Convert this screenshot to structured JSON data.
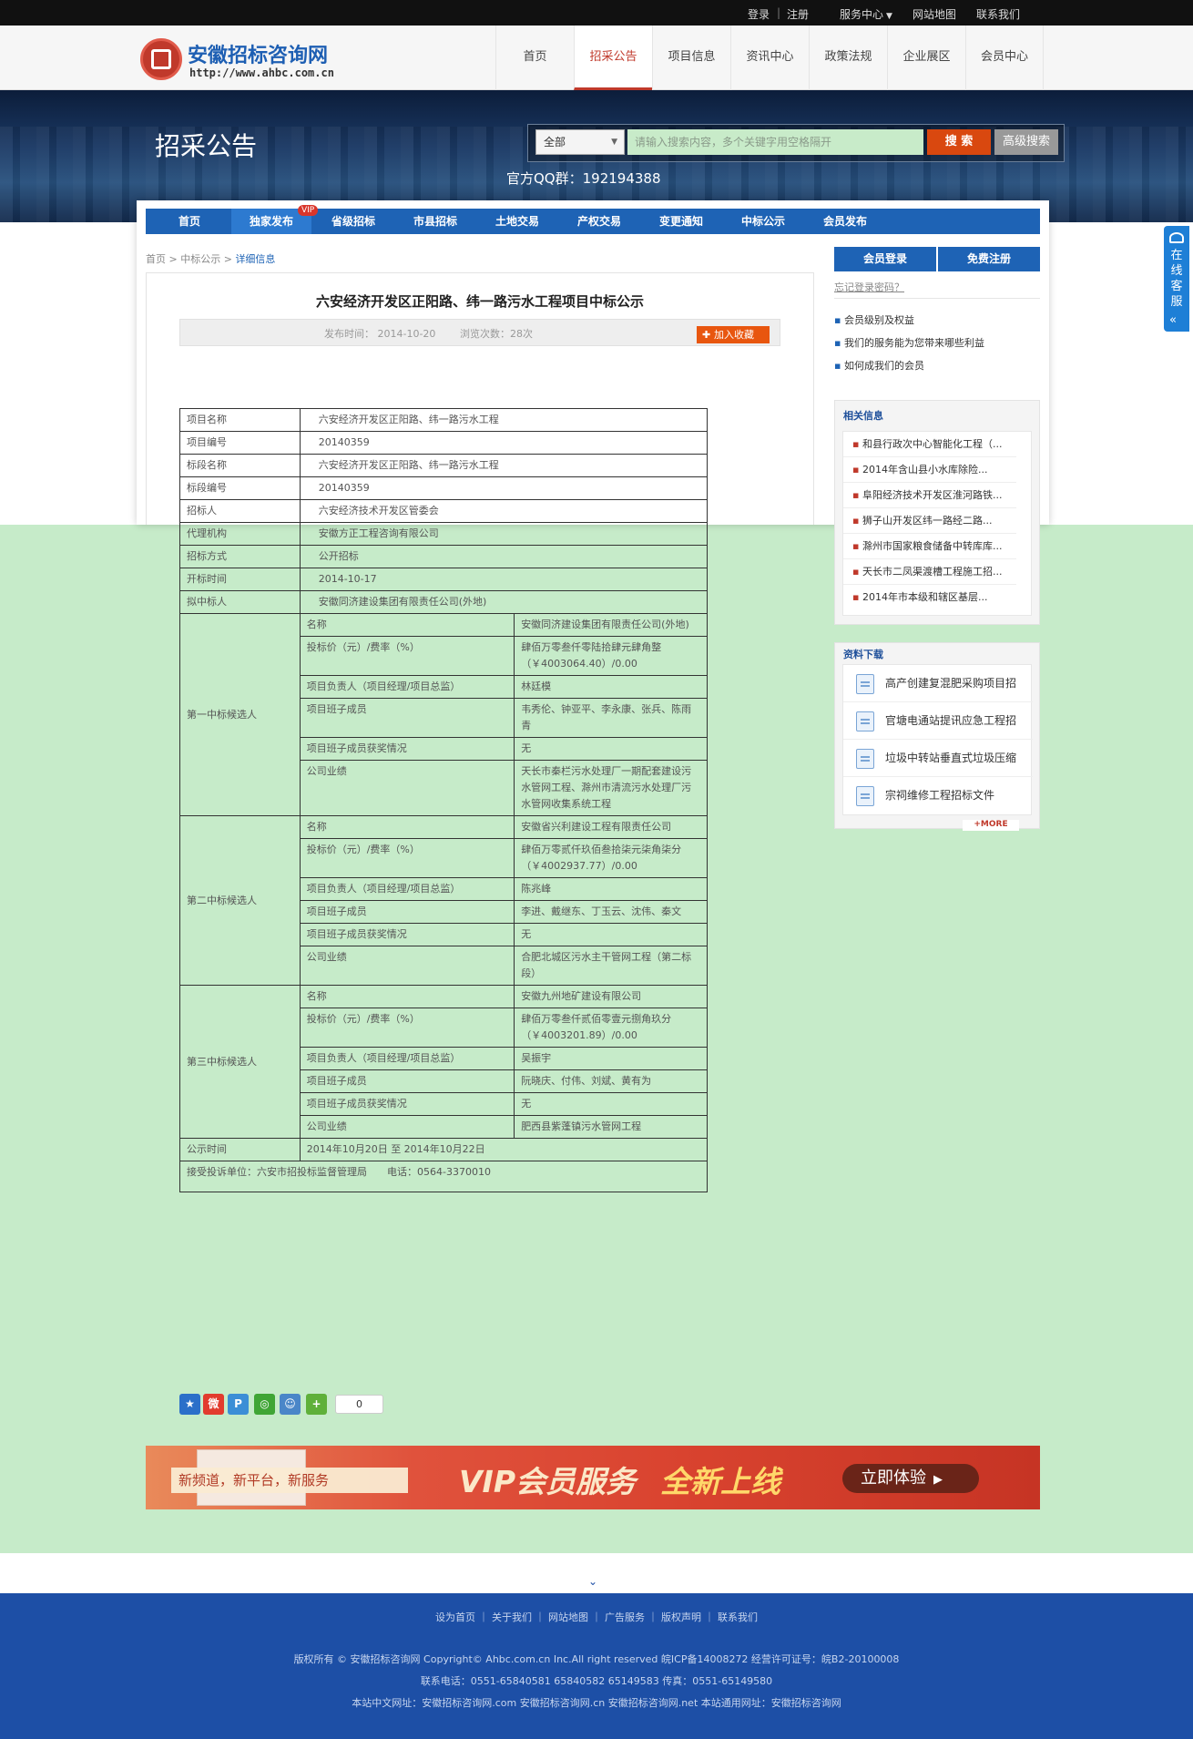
{
  "topbar": {
    "login": "登录",
    "sep": "|",
    "register": "注册",
    "service": "服务中心",
    "sitemap": "网站地图",
    "contact": "联系我们"
  },
  "header": {
    "logo_cn": "安徽招标咨询网",
    "logo_url": "http://www.ahbc.com.cn",
    "nav": [
      "首页",
      "招采公告",
      "项目信息",
      "资讯中心",
      "政策法规",
      "企业展区",
      "会员中心"
    ]
  },
  "banner": {
    "title": "招采公告",
    "select_value": "全部",
    "search_placeholder": "请输入搜索内容，多个关键字用空格隔开",
    "search_btn": "搜 索",
    "adv_btn": "高级搜索",
    "qq": "官方QQ群：192194388"
  },
  "subnav": [
    "首页",
    "独家发布",
    "省级招标",
    "市县招标",
    "土地交易",
    "产权交易",
    "变更通知",
    "中标公示",
    "会员发布"
  ],
  "vip_badge": "VIP",
  "breadcrumb": [
    "首页",
    "中标公示",
    "详细信息"
  ],
  "article": {
    "title": "六安经济开发区正阳路、纬一路污水工程项目中标公示",
    "publish": "发布时间： 2014-10-20",
    "views": "浏览次数：28次",
    "fav_btn": "加入收藏"
  },
  "table": {
    "rows": [
      {
        "k": "项目名称",
        "v": "六安经济开发区正阳路、纬一路污水工程"
      },
      {
        "k": "项目编号",
        "v": "20140359"
      },
      {
        "k": "标段名称",
        "v": "六安经济开发区正阳路、纬一路污水工程"
      },
      {
        "k": "标段编号",
        "v": "20140359"
      },
      {
        "k": "招标人",
        "v": "六安经济技术开发区管委会"
      },
      {
        "k": "代理机构",
        "v": "安徽方正工程咨询有限公司"
      },
      {
        "k": "招标方式",
        "v": "公开招标"
      },
      {
        "k": "开标时间",
        "v": "2014-10-17"
      },
      {
        "k": "拟中标人",
        "v": "安徽同济建设集团有限责任公司(外地)"
      }
    ],
    "candidates": [
      {
        "label": "第一中标候选人",
        "rows": [
          {
            "k": "名称",
            "v": "安徽同济建设集团有限责任公司(外地)"
          },
          {
            "k": "投标价（元）/费率（%）",
            "v": "肆佰万零叁仟零陆拾肆元肆角整（￥4003064.40）/0.00"
          },
          {
            "k": "项目负责人（项目经理/项目总监）",
            "v": "林廷模"
          },
          {
            "k": "项目班子成员",
            "v": "韦秀伦、钟亚平、李永康、张兵、陈雨青"
          },
          {
            "k": "项目班子成员获奖情况",
            "v": "无"
          },
          {
            "k": "公司业绩",
            "v": "天长市秦栏污水处理厂一期配套建设污水管网工程、滁州市清流污水处理厂污水管网收集系统工程"
          }
        ]
      },
      {
        "label": "第二中标候选人",
        "rows": [
          {
            "k": "名称",
            "v": "安徽省兴利建设工程有限责任公司"
          },
          {
            "k": "投标价（元）/费率（%）",
            "v": "肆佰万零贰仟玖佰叁拾柒元柒角柒分（￥4002937.77）/0.00"
          },
          {
            "k": "项目负责人（项目经理/项目总监）",
            "v": "陈兆峰"
          },
          {
            "k": "项目班子成员",
            "v": "李进、戴继东、丁玉云、沈伟、秦文"
          },
          {
            "k": "项目班子成员获奖情况",
            "v": "无"
          },
          {
            "k": "公司业绩",
            "v": "合肥北城区污水主干管网工程（第二标段）"
          }
        ]
      },
      {
        "label": "第三中标候选人",
        "rows": [
          {
            "k": "名称",
            "v": "安徽九州地矿建设有限公司"
          },
          {
            "k": "投标价（元）/费率（%）",
            "v": "肆佰万零叁仟贰佰零壹元捌角玖分（￥4003201.89）/0.00"
          },
          {
            "k": "项目负责人（项目经理/项目总监）",
            "v": "吴振宇"
          },
          {
            "k": "项目班子成员",
            "v": "阮晓庆、付伟、刘斌、黄有为"
          },
          {
            "k": "项目班子成员获奖情况",
            "v": "无"
          },
          {
            "k": "公司业绩",
            "v": "肥西县紫蓬镇污水管网工程"
          }
        ]
      }
    ],
    "notice_k": "公示时间",
    "notice_v": "2014年10月20日 至 2014年10月22日",
    "complaint": "接受投诉单位：六安市招投标监督管理局　　电话：0564-3370010"
  },
  "share_count": "0",
  "vip_banner": {
    "left": "新频道，新平台，新服务",
    "main": "VIP会员服务",
    "accent": "全新上线",
    "btn": "立即体验"
  },
  "side": {
    "login": "会员登录",
    "register": "免费注册",
    "forgot": "忘记登录密码？",
    "links": [
      "会员级别及权益",
      "我们的服务能为您带来哪些利益",
      "如何成我们的会员"
    ],
    "related_title": "相关信息",
    "related": [
      "和县行政次中心智能化工程（...",
      "2014年含山县小水库除险...",
      "阜阳经济技术开发区淮河路铁...",
      "狮子山开发区纬一路经二路...",
      "滁州市国家粮食储备中转库库...",
      "天长市二凤渠渡槽工程施工招...",
      "2014年市本级和辖区基层..."
    ],
    "download_title": "资料下载",
    "downloads": [
      "高产创建复混肥采购项目招",
      "官塘电通站提讯应急工程招",
      "垃圾中转站垂直式垃圾压缩",
      "宗祠维修工程招标文件"
    ],
    "more": "+MORE",
    "online_service": "在线客服"
  },
  "footer": {
    "links": [
      "设为首页",
      "关于我们",
      "网站地图",
      "广告服务",
      "版权声明",
      "联系我们"
    ],
    "line1": "版权所有 © 安徽招标咨询网 Copyright© Ahbc.com.cn Inc.All right reserved 皖ICP备14008272 经营许可证号：皖B2-20100008",
    "line2": "联系电话：0551-65840581 65840582 65149583 传真：0551-65149580",
    "line3": "本站中文网址：安徽招标咨询网.com 安徽招标咨询网.cn 安徽招标咨询网.net 本站通用网址：安徽招标咨询网"
  }
}
